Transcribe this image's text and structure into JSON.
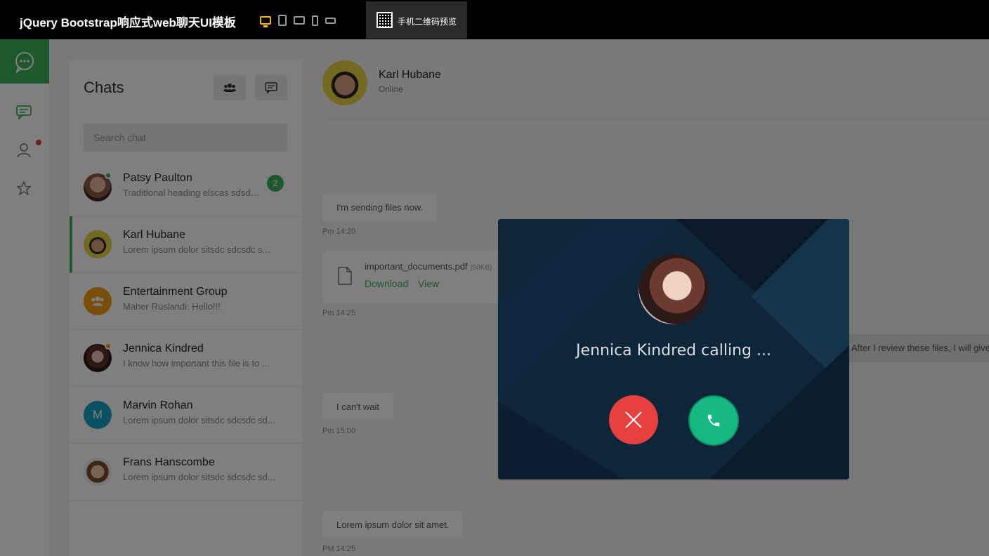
{
  "topbar": {
    "title": "jQuery Bootstrap响应式web聊天UI模板",
    "qr_label": "手机二维码预览",
    "active_color": "#f5b800"
  },
  "nav": {
    "accent": "#3db15a",
    "icons": [
      "chat-logo-icon",
      "chats-icon",
      "user-icon",
      "star-icon"
    ],
    "notification_color": "#e73c3c"
  },
  "chats": {
    "title": "Chats",
    "search_placeholder": "Search chat",
    "items": [
      {
        "name": "Patsy Paulton",
        "preview": "Traditional heading elscas sdsd…",
        "badge": "2",
        "status": "online"
      },
      {
        "name": "Karl Hubane",
        "preview": "Lorem ipsum dolor sitsdc sdcsdc s...",
        "active": true
      },
      {
        "name": "Entertainment Group",
        "preview": "Maher Ruslandi: Hello!!!"
      },
      {
        "name": "Jennica Kindred",
        "preview": "I know how important this file is to ...",
        "status": "away"
      },
      {
        "name": "Marvin Rohan",
        "preview": "Lorem ipsum dolor sitsdc sdcsdc sd...",
        "initial": "M"
      },
      {
        "name": "Frans Hanscombe",
        "preview": "Lorem ipsum dolor sitsdc sdcsdc sd..."
      }
    ]
  },
  "conversation": {
    "contact_name": "Karl Hubane",
    "contact_status": "Online",
    "messages": [
      {
        "text": "I'm sending files now.",
        "time": "Pm 14:20"
      },
      {
        "file_name": "important_documents.pdf",
        "file_size": "(50KB)",
        "download": "Download",
        "view": "View",
        "time": "Pm 14:25"
      },
      {
        "text": "After I review these files, I will give..."
      },
      {
        "text": "I can't wait",
        "time": "Pm 15:00"
      },
      {
        "text": "Lorem ipsum dolor sit amet.",
        "time": "PM 14:25"
      }
    ]
  },
  "call": {
    "caller": "Jennica Kindred calling ...",
    "reject_color": "#e8403f",
    "accept_color": "#16b982"
  }
}
